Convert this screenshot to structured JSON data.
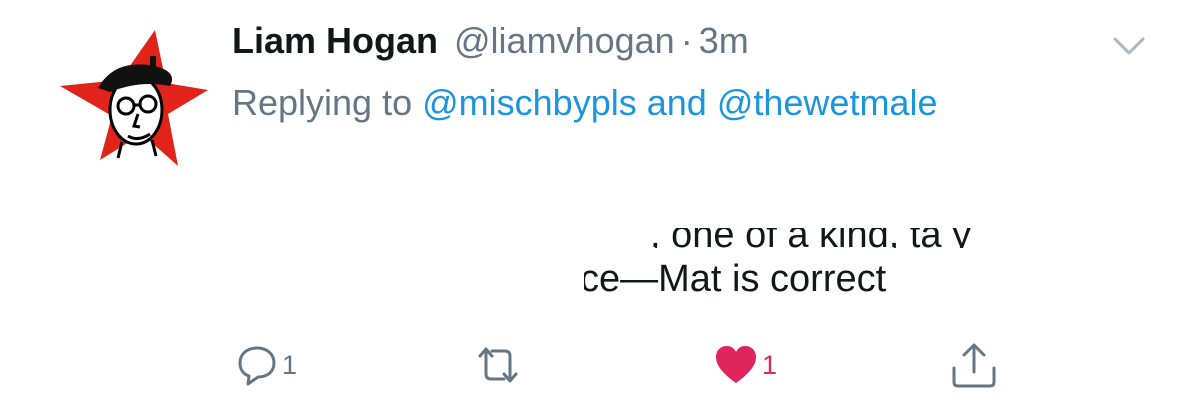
{
  "tweet": {
    "author_name": "Liam Hogan",
    "author_handle": "@liamvhogan",
    "separator": "·",
    "timestamp": "3m",
    "replying_prefix": "Replying to",
    "mention_1": "@mischbypls",
    "conjunction": "and",
    "mention_2": "@thewetmale",
    "body_line_1_partial": ", one of a kind, ta   y",
    "body_line_2": "ce—Mat is correct"
  },
  "actions": {
    "reply_count": "1",
    "like_count": "1"
  },
  "colors": {
    "text_primary": "#14171a",
    "text_secondary": "#657786",
    "link": "#1b95e0",
    "like": "#e0245e",
    "avatar_star": "#e2231a"
  },
  "icons": [
    "avatar-star-portrait",
    "chevron-down-icon",
    "reply-icon",
    "retweet-icon",
    "heart-icon",
    "share-icon"
  ]
}
